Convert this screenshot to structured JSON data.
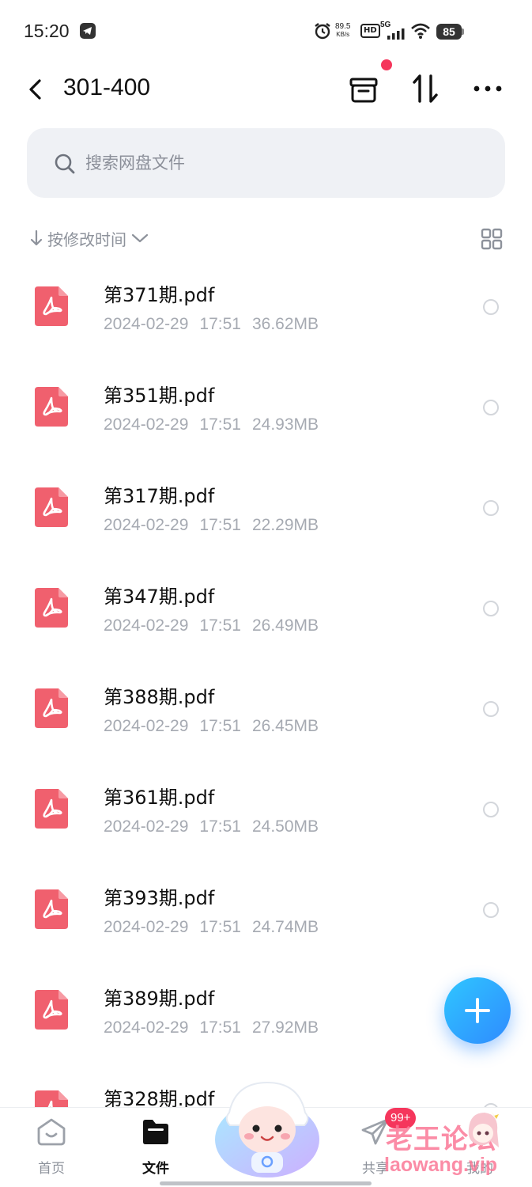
{
  "status_bar": {
    "time": "15:20",
    "net_speed_value": "89.5",
    "net_speed_unit": "KB/s",
    "hd": "HD",
    "signal": "5G",
    "battery": "85"
  },
  "header": {
    "title": "301-400",
    "icons": [
      "back-icon",
      "archive-icon",
      "sort-icon",
      "more-icon"
    ],
    "notification_dot_color": "#f5365c"
  },
  "search": {
    "placeholder": "搜索网盘文件"
  },
  "sort": {
    "label": "按修改时间"
  },
  "files": [
    {
      "name": "第371期.pdf",
      "date": "2024-02-29",
      "time": "17:51",
      "size": "36.62MB"
    },
    {
      "name": "第351期.pdf",
      "date": "2024-02-29",
      "time": "17:51",
      "size": "24.93MB"
    },
    {
      "name": "第317期.pdf",
      "date": "2024-02-29",
      "time": "17:51",
      "size": "22.29MB"
    },
    {
      "name": "第347期.pdf",
      "date": "2024-02-29",
      "time": "17:51",
      "size": "26.49MB"
    },
    {
      "name": "第388期.pdf",
      "date": "2024-02-29",
      "time": "17:51",
      "size": "26.45MB"
    },
    {
      "name": "第361期.pdf",
      "date": "2024-02-29",
      "time": "17:51",
      "size": "24.50MB"
    },
    {
      "name": "第393期.pdf",
      "date": "2024-02-29",
      "time": "17:51",
      "size": "24.74MB"
    },
    {
      "name": "第389期.pdf",
      "date": "2024-02-29",
      "time": "17:51",
      "size": "27.92MB"
    },
    {
      "name": "第328期.pdf",
      "date": "",
      "time": "",
      "size": ""
    }
  ],
  "bottom_nav": {
    "home": "首页",
    "files": "文件",
    "share": "共享",
    "mine": "我的",
    "share_badge": "99+"
  },
  "watermark": {
    "text": "老王论坛",
    "sub": "laowang.vip"
  },
  "colors": {
    "accent": "#2f8bff",
    "pdf": "#f0606e",
    "badge": "#f5365c"
  }
}
